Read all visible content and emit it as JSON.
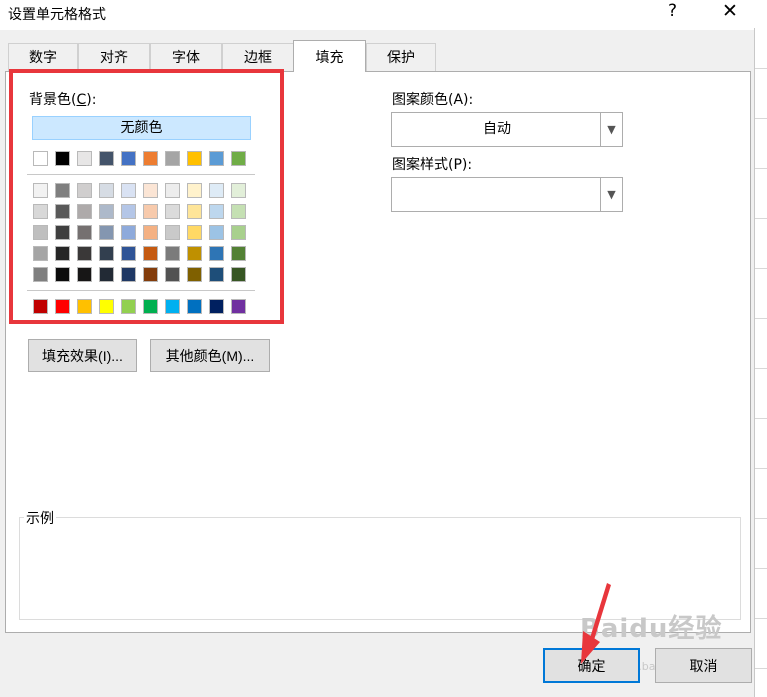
{
  "dialog": {
    "title": "设置单元格格式",
    "help": "?",
    "close": "✕"
  },
  "tabs": [
    {
      "label": "数字"
    },
    {
      "label": "对齐"
    },
    {
      "label": "字体"
    },
    {
      "label": "边框"
    },
    {
      "label": "填充",
      "active": true
    },
    {
      "label": "保护"
    }
  ],
  "background": {
    "label": "背景色(C):",
    "no_color": "无颜色",
    "theme_row": [
      "#ffffff",
      "#000000",
      "#e7e6e6",
      "#44546a",
      "#4472c4",
      "#ed7d31",
      "#a5a5a5",
      "#ffc000",
      "#5b9bd5",
      "#70ad47"
    ],
    "tint_rows": [
      [
        "#f2f2f2",
        "#7f7f7f",
        "#d0cece",
        "#d6dce4",
        "#d9e2f3",
        "#fbe5d5",
        "#ededed",
        "#fff2cc",
        "#deebf6",
        "#e2efd9"
      ],
      [
        "#d8d8d8",
        "#595959",
        "#aeaaaa",
        "#adb9ca",
        "#b4c6e7",
        "#f7caac",
        "#dbdbdb",
        "#fee599",
        "#bdd7ee",
        "#c5e0b3"
      ],
      [
        "#bfbfbf",
        "#3f3f3f",
        "#757070",
        "#8496b0",
        "#8eaadb",
        "#f4b183",
        "#c9c9c9",
        "#ffd965",
        "#9cc3e5",
        "#a8d08d"
      ],
      [
        "#a5a5a5",
        "#262626",
        "#3a3838",
        "#323f4f",
        "#2f5496",
        "#c55a11",
        "#7b7b7b",
        "#bf9000",
        "#2e75b5",
        "#538135"
      ],
      [
        "#7f7f7f",
        "#0c0c0c",
        "#171616",
        "#222a35",
        "#1f3864",
        "#833c0b",
        "#525252",
        "#7f6000",
        "#1e4e79",
        "#375623"
      ]
    ],
    "standard_row": [
      "#c00000",
      "#ff0000",
      "#ffc000",
      "#ffff00",
      "#92d050",
      "#00b050",
      "#00b0f0",
      "#0070c0",
      "#002060",
      "#7030a0"
    ]
  },
  "buttons": {
    "fill_effects": "填充效果(I)...",
    "more_colors": "其他颜色(M)..."
  },
  "pattern": {
    "color_label": "图案颜色(A):",
    "color_value": "自动",
    "style_label": "图案样式(P):",
    "style_value": ""
  },
  "sample_label": "示例",
  "footer": {
    "ok": "确定",
    "cancel": "取消"
  },
  "watermark": {
    "main": "Baidu经验",
    "sub": "jingyan.baidu.com"
  },
  "highlight_color": "#e8363c"
}
